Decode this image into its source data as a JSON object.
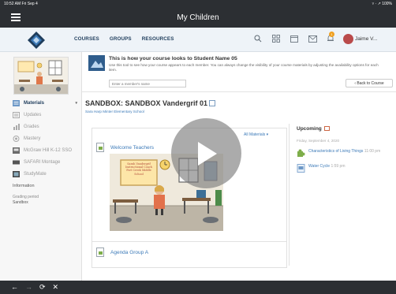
{
  "status": {
    "time": "10:52 AM  Fri Sep 4",
    "right": "▿ · ↗ 100%"
  },
  "app": {
    "title": "My Children"
  },
  "nav": {
    "links": [
      "COURSES",
      "GROUPS",
      "RESOURCES"
    ],
    "user": "Jaime V...",
    "notification_count": "1"
  },
  "sidebar": {
    "items": [
      {
        "label": "Materials",
        "icon": "materials-icon"
      },
      {
        "label": "Updates",
        "icon": "updates-icon"
      },
      {
        "label": "Grades",
        "icon": "grades-icon"
      },
      {
        "label": "Mastery",
        "icon": "mastery-icon"
      },
      {
        "label": "McGraw Hill K-12 SSO",
        "icon": "mcgraw-icon"
      },
      {
        "label": "SAFARI Montage",
        "icon": "safari-icon"
      },
      {
        "label": "StudyMate",
        "icon": "studymate-icon"
      }
    ],
    "section_label": "Information",
    "grading_period_label": "Grading period",
    "grading_period_value": "Sandbox"
  },
  "banner": {
    "title": "This is how your course looks to Student Name 05",
    "description": "Use this tool to see how your course appears to each member. You can always change the visibility of your course materials by adjusting the availability options for each item.",
    "input_placeholder": "Enter a member's name",
    "back_button": "‹ Back to Course"
  },
  "page": {
    "title": "SANDBOX: SANDBOX Vandergrif 01",
    "school": "Sara Harp Minter Elementary School",
    "filter_label": "All Materials ▾"
  },
  "materials": [
    {
      "label": "Welcome Teachers"
    },
    {
      "label": "Agenda Group A"
    }
  ],
  "classroom_image": {
    "board_lines": [
      "Sarah Vandergrif",
      "Instructional Coach",
      "Fort Creek Middle School"
    ]
  },
  "upcoming": {
    "title": "Upcoming",
    "date": "Friday, September 4, 2020",
    "events": [
      {
        "title": "Characteristics of Living Things",
        "time": "11:00 pm"
      },
      {
        "title": "Water Cycle",
        "time": "1:59 pm"
      }
    ]
  },
  "bottom_bar": [
    "←",
    "→",
    "⟳",
    "✕"
  ],
  "colors": {
    "dark": "#2c2f33",
    "link": "#3c7ab8",
    "nav_bg": "#eef3f8"
  }
}
